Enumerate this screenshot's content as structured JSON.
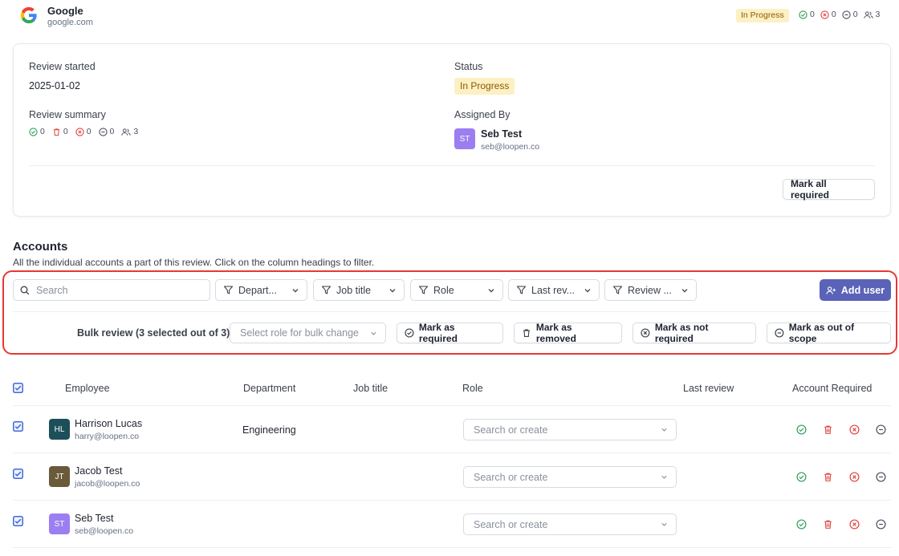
{
  "header": {
    "app_name": "Google",
    "app_domain": "google.com",
    "status": "In Progress",
    "stats": {
      "approved": "0",
      "rejected": "0",
      "not_required": "0",
      "users": "3"
    }
  },
  "review": {
    "started_label": "Review started",
    "started_value": "2025-01-02",
    "status_label": "Status",
    "status_value": "In Progress",
    "summary_label": "Review summary",
    "summary_stats": {
      "approved": "0",
      "removed": "0",
      "rejected": "0",
      "not_required": "0",
      "users": "3"
    },
    "assigned_label": "Assigned By",
    "assigned_initials": "ST",
    "assigned_name": "Seb Test",
    "assigned_email": "seb@loopen.co",
    "mark_all_label": "Mark all required"
  },
  "accounts": {
    "title": "Accounts",
    "subtitle": "All the individual accounts a part of this review. Click on the column headings to filter.",
    "search_placeholder": "Search",
    "filters": [
      "Depart...",
      "Job title",
      "Role",
      "Last rev...",
      "Review ..."
    ],
    "add_user_label": "Add user",
    "bulk": {
      "label": "Bulk review (3 selected out of 3)",
      "select_placeholder": "Select role for bulk change",
      "buttons": [
        "Mark as required",
        "Mark as removed",
        "Mark as not required",
        "Mark as out of scope"
      ]
    },
    "columns": [
      "Employee",
      "Department",
      "Job title",
      "Role",
      "Last review",
      "Account Required"
    ],
    "rows": [
      {
        "initials": "HL",
        "name": "Harrison Lucas",
        "email": "harry@loopen.co",
        "department": "Engineering",
        "role_placeholder": "Search or create",
        "avatar_color": "#1d4f5a"
      },
      {
        "initials": "JT",
        "name": "Jacob Test",
        "email": "jacob@loopen.co",
        "department": "",
        "role_placeholder": "Search or create",
        "avatar_color": "#6b5a3a"
      },
      {
        "initials": "ST",
        "name": "Seb Test",
        "email": "seb@loopen.co",
        "department": "",
        "role_placeholder": "Search or create",
        "avatar_color": "#9b7ef0"
      }
    ]
  },
  "colors": {
    "accent": "#5a63b8",
    "highlight": "#e53935",
    "approve": "#2e9e5b",
    "reject": "#e0453f",
    "badge_bg": "#fdf0c4"
  }
}
